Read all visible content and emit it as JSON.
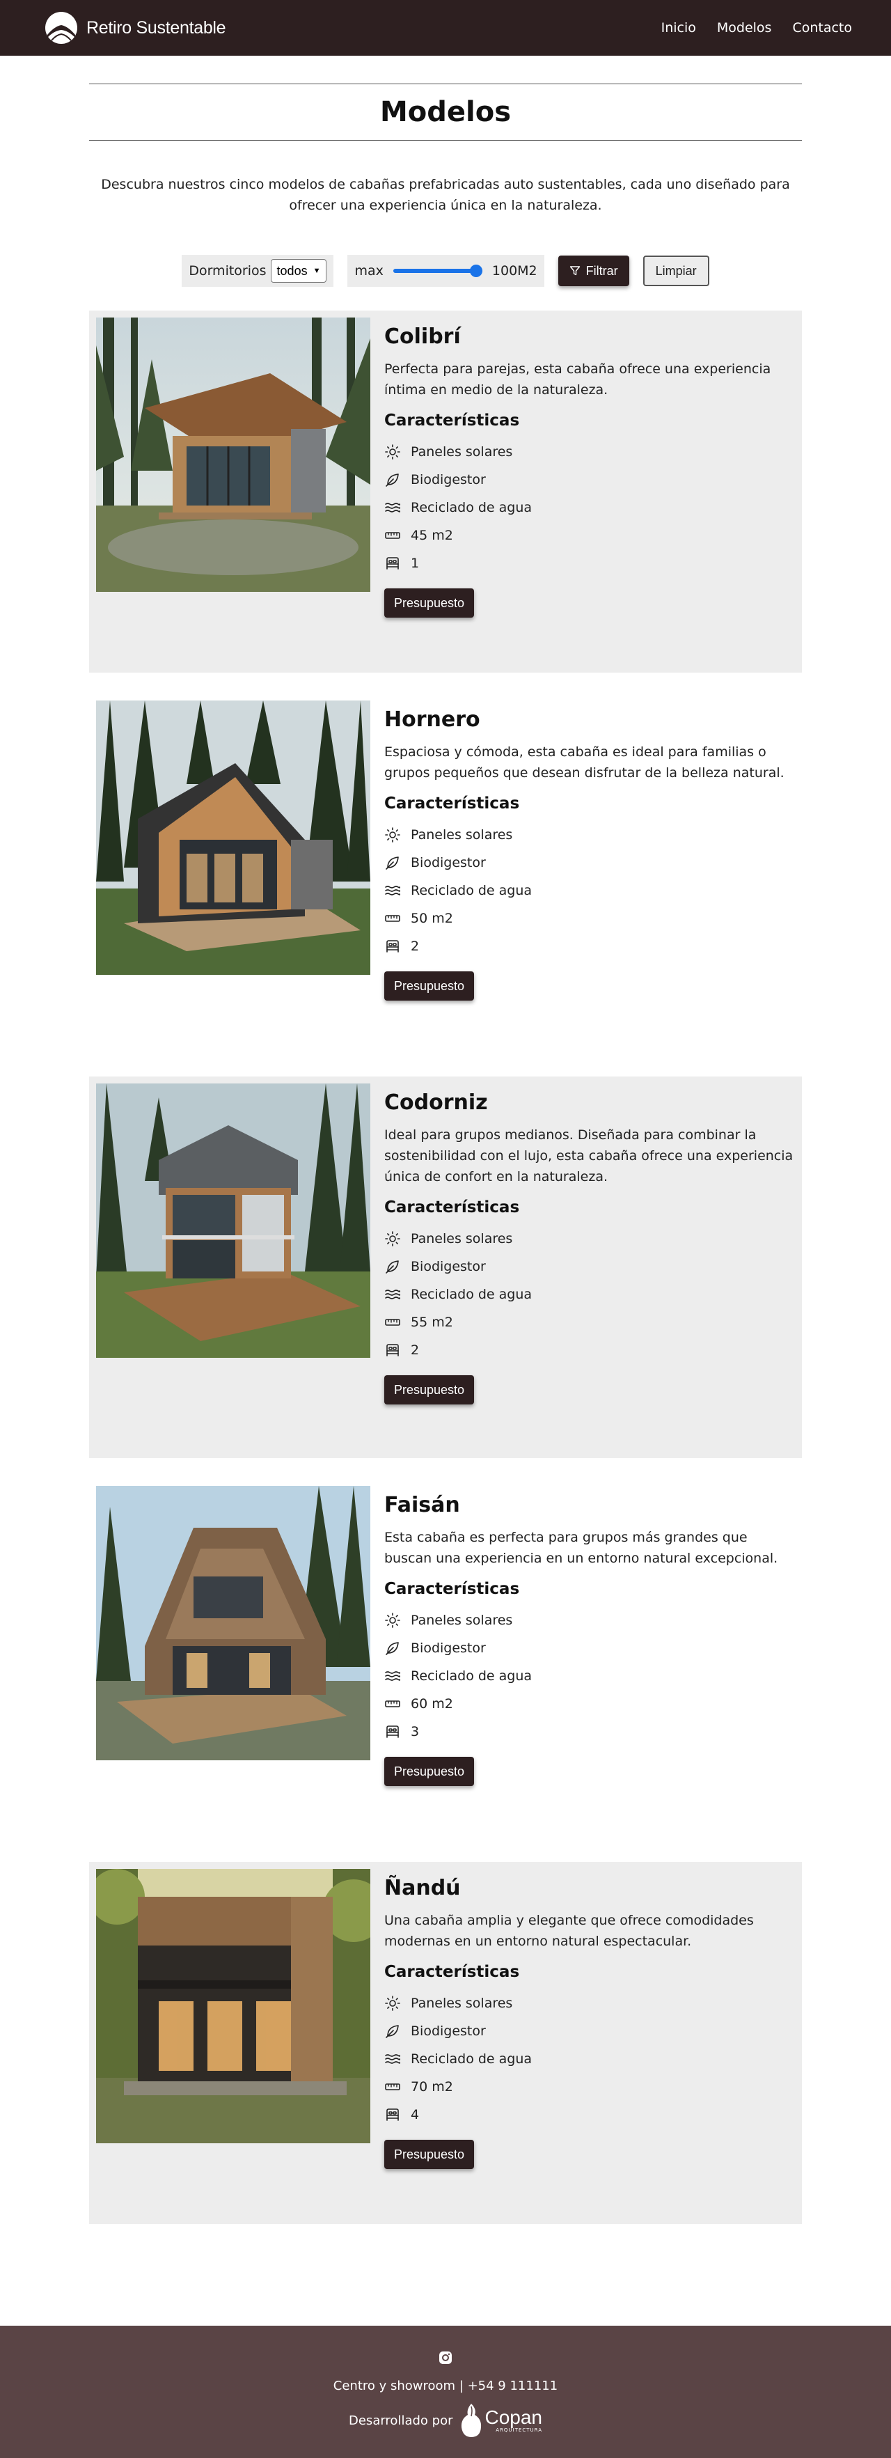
{
  "nav": {
    "brand": "Retiro Sustentable",
    "links": [
      "Inicio",
      "Modelos",
      "Contacto"
    ]
  },
  "page": {
    "title": "Modelos",
    "intro": "Descubra nuestros cinco modelos de cabañas prefabricadas auto sustentables, cada uno diseñado para ofrecer una experiencia única en la naturaleza."
  },
  "filters": {
    "bedrooms_label": "Dormitorios",
    "bedrooms_selected": "todos",
    "max_label": "max",
    "max_value_label": "100M2",
    "max_slider_fraction": 1.0,
    "filter_button": "Filtrar",
    "clear_button": "Limpiar"
  },
  "feature_heading": "Características",
  "budget_button": "Presupuesto",
  "features": {
    "solar": "Paneles solares",
    "biodigester": "Biodigestor",
    "water": "Reciclado de agua"
  },
  "models": [
    {
      "name": "Colibrí",
      "description": "Perfecta para parejas, esta cabaña ofrece una experiencia íntima en medio de la naturaleza.",
      "area": "45 m2",
      "bedrooms": "1"
    },
    {
      "name": "Hornero",
      "description": "Espaciosa y cómoda, esta cabaña es ideal para familias o grupos pequeños que desean disfrutar de la belleza natural.",
      "area": "50 m2",
      "bedrooms": "2"
    },
    {
      "name": "Codorniz",
      "description": "Ideal para grupos medianos. Diseñada para combinar la sostenibilidad con el lujo, esta cabaña ofrece una experiencia única de confort en la naturaleza.",
      "area": "55 m2",
      "bedrooms": "2"
    },
    {
      "name": "Faisán",
      "description": "Esta cabaña es perfecta para grupos más grandes que buscan una experiencia en un entorno natural excepcional.",
      "area": "60 m2",
      "bedrooms": "3"
    },
    {
      "name": "Ñandú",
      "description": "Una cabaña amplia y elegante que ofrece comodidades modernas en un entorno natural espectacular.",
      "area": "70 m2",
      "bedrooms": "4"
    }
  ],
  "footer": {
    "contact": "Centro y showroom | +54 9 111111",
    "developed_by": "Desarrollado por",
    "dev_brand": "Copan",
    "dev_brand_sub": "ARQUITECTURA"
  },
  "colors": {
    "nav_bg": "#2d1f20",
    "footer_bg": "#5a4445",
    "card_shade": "#ededed",
    "accent_blue": "#1a73e8"
  }
}
